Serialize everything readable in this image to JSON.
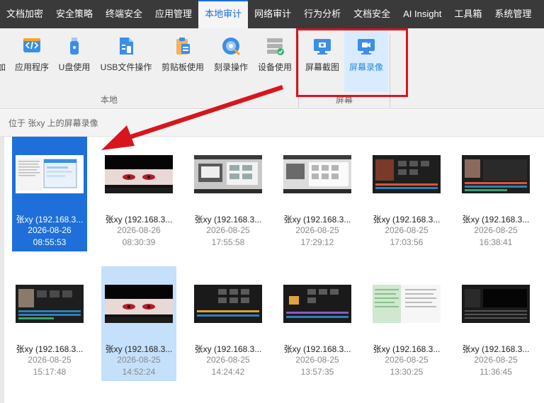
{
  "menu": [
    {
      "label": "文档加密"
    },
    {
      "label": "安全策略"
    },
    {
      "label": "终端安全"
    },
    {
      "label": "应用管理"
    },
    {
      "label": "本地审计",
      "active": true
    },
    {
      "label": "网络审计"
    },
    {
      "label": "行为分析"
    },
    {
      "label": "文档安全"
    },
    {
      "label": "AI Insight"
    },
    {
      "label": "工具箱"
    },
    {
      "label": "系统管理"
    }
  ],
  "ribbon": {
    "partial_label": "加",
    "buttons": [
      {
        "label": "应用程序",
        "icon": "code-icon"
      },
      {
        "label": "U盘使用",
        "icon": "usb-icon"
      },
      {
        "label": "USB文件操作",
        "icon": "usb-file-icon"
      },
      {
        "label": "剪贴板使用",
        "icon": "clipboard-icon"
      },
      {
        "label": "刻录操作",
        "icon": "disc-icon"
      },
      {
        "label": "设备使用",
        "icon": "device-icon"
      },
      {
        "label": "屏幕截图",
        "icon": "screenshot-icon"
      },
      {
        "label": "屏幕录像",
        "icon": "screen-record-icon",
        "selected": true
      }
    ],
    "group_local": "本地",
    "group_screen": "屏幕"
  },
  "path": "位于 张xy 上的屏幕录像",
  "recordings": [
    {
      "name": "张xy (192.168.3...",
      "date": "2026-08-26",
      "time": "08:55:53",
      "thumb": "doc-window"
    },
    {
      "name": "张xy (192.168.3...",
      "date": "2026-08-26",
      "time": "08:30:39",
      "thumb": "anime-face"
    },
    {
      "name": "张xy (192.168.3...",
      "date": "2026-08-25",
      "time": "17:55:58",
      "thumb": "gray-desktop"
    },
    {
      "name": "张xy (192.168.3...",
      "date": "2026-08-25",
      "time": "17:29:12",
      "thumb": "gray-desktop"
    },
    {
      "name": "张xy (192.168.3...",
      "date": "2026-08-25",
      "time": "17:03:56",
      "thumb": "dark-editor"
    },
    {
      "name": "张xy (192.168.3...",
      "date": "2026-08-25",
      "time": "16:38:41",
      "thumb": "dark-editor"
    },
    {
      "name": "张xy (192.168.3...",
      "date": "2026-08-25",
      "time": "15:17:48",
      "thumb": "dark-editor"
    },
    {
      "name": "张xy (192.168.3...",
      "date": "2026-08-25",
      "time": "14:52:24",
      "thumb": "anime-face"
    },
    {
      "name": "张xy (192.168.3...",
      "date": "2026-08-25",
      "time": "14:24:42",
      "thumb": "dark-editor"
    },
    {
      "name": "张xy (192.168.3...",
      "date": "2026-08-25",
      "time": "13:57:35",
      "thumb": "dark-editor"
    },
    {
      "name": "张xy (192.168.3...",
      "date": "2026-08-25",
      "time": "13:30:25",
      "thumb": "green-sheet"
    },
    {
      "name": "张xy (192.168.3...",
      "date": "2026-08-25",
      "time": "11:36:45",
      "thumb": "dark-editor"
    }
  ],
  "colors": {
    "accent": "#1e6fd9",
    "highlight_box": "#d8151c",
    "selected_tile": "#1e6fd9",
    "hover_tile": "#c5e0fb"
  }
}
